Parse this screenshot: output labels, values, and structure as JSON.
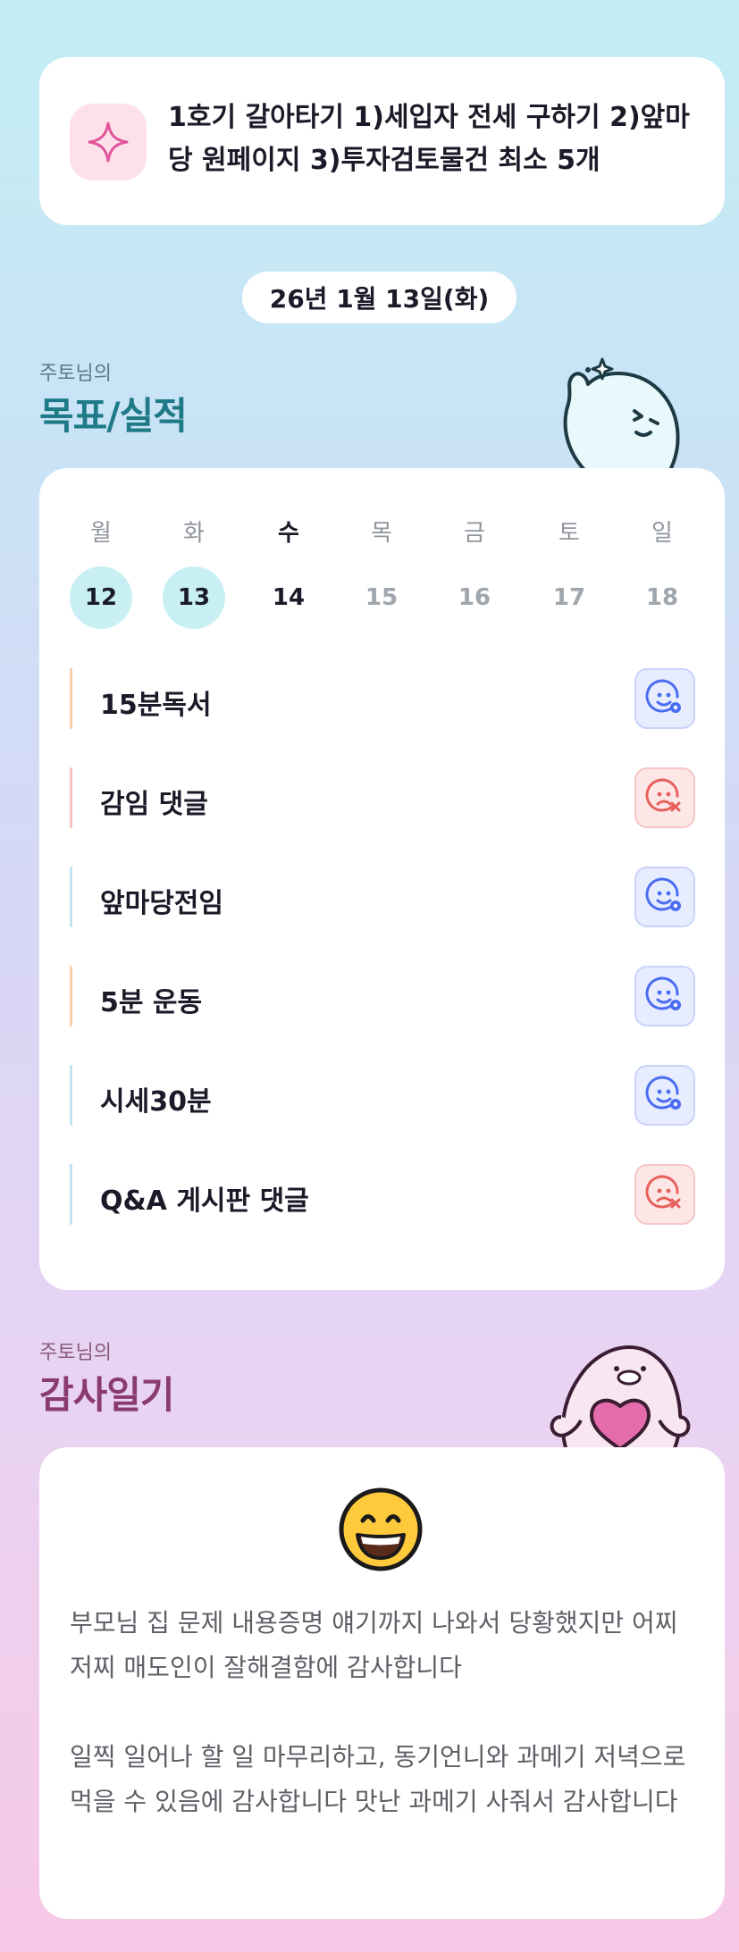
{
  "goal_banner": {
    "icon": "sparkle-icon",
    "text": "1호기 갈아타기 1)세입자 전세 구하기 2)앞마당 원페이지 3)투자검토물건 최소 5개"
  },
  "date_label": "26년 1월 13일(화)",
  "goals_section": {
    "owner": "주토님의",
    "title": "목표/실적",
    "title_color": "#1e7a86"
  },
  "week": {
    "days": [
      {
        "label": "월",
        "date": "12",
        "state": "done"
      },
      {
        "label": "화",
        "date": "13",
        "state": "done"
      },
      {
        "label": "수",
        "date": "14",
        "state": "today"
      },
      {
        "label": "목",
        "date": "15",
        "state": "future"
      },
      {
        "label": "금",
        "date": "16",
        "state": "future"
      },
      {
        "label": "토",
        "date": "17",
        "state": "future"
      },
      {
        "label": "일",
        "date": "18",
        "state": "future"
      }
    ]
  },
  "tasks": [
    {
      "label": "15분독서",
      "status": "ok",
      "accent": "#f9cfa9"
    },
    {
      "label": "감임 댓글",
      "status": "fail",
      "accent": "#f7c2c0"
    },
    {
      "label": "앞마당전임",
      "status": "ok",
      "accent": "#bfe3ef"
    },
    {
      "label": "5분 운동",
      "status": "ok",
      "accent": "#f9cfa9"
    },
    {
      "label": "시세30분",
      "status": "ok",
      "accent": "#bfe3ef"
    },
    {
      "label": "Q&A 게시판 댓글",
      "status": "fail",
      "accent": "#bfe3ef"
    }
  ],
  "diary_section": {
    "owner": "주토님의",
    "title": "감사일기",
    "title_color": "#8a3a73"
  },
  "diary": {
    "mood_icon": "grinning-face-icon",
    "paragraphs": [
      "부모님 집 문제 내용증명 얘기까지 나와서 당황했지만 어찌저찌 매도인이 잘해결함에 감사합니다",
      "일찍 일어나 할 일 마무리하고, 동기언니와 과메기 저녁으로 먹을 수 있음에 감사합니다 맛난 과메기 사줘서 감사합니다"
    ]
  },
  "colors": {
    "ok_icon": "#4a6cf0",
    "fail_icon": "#e8605b",
    "done_day_bg": "#c8f0f4"
  }
}
